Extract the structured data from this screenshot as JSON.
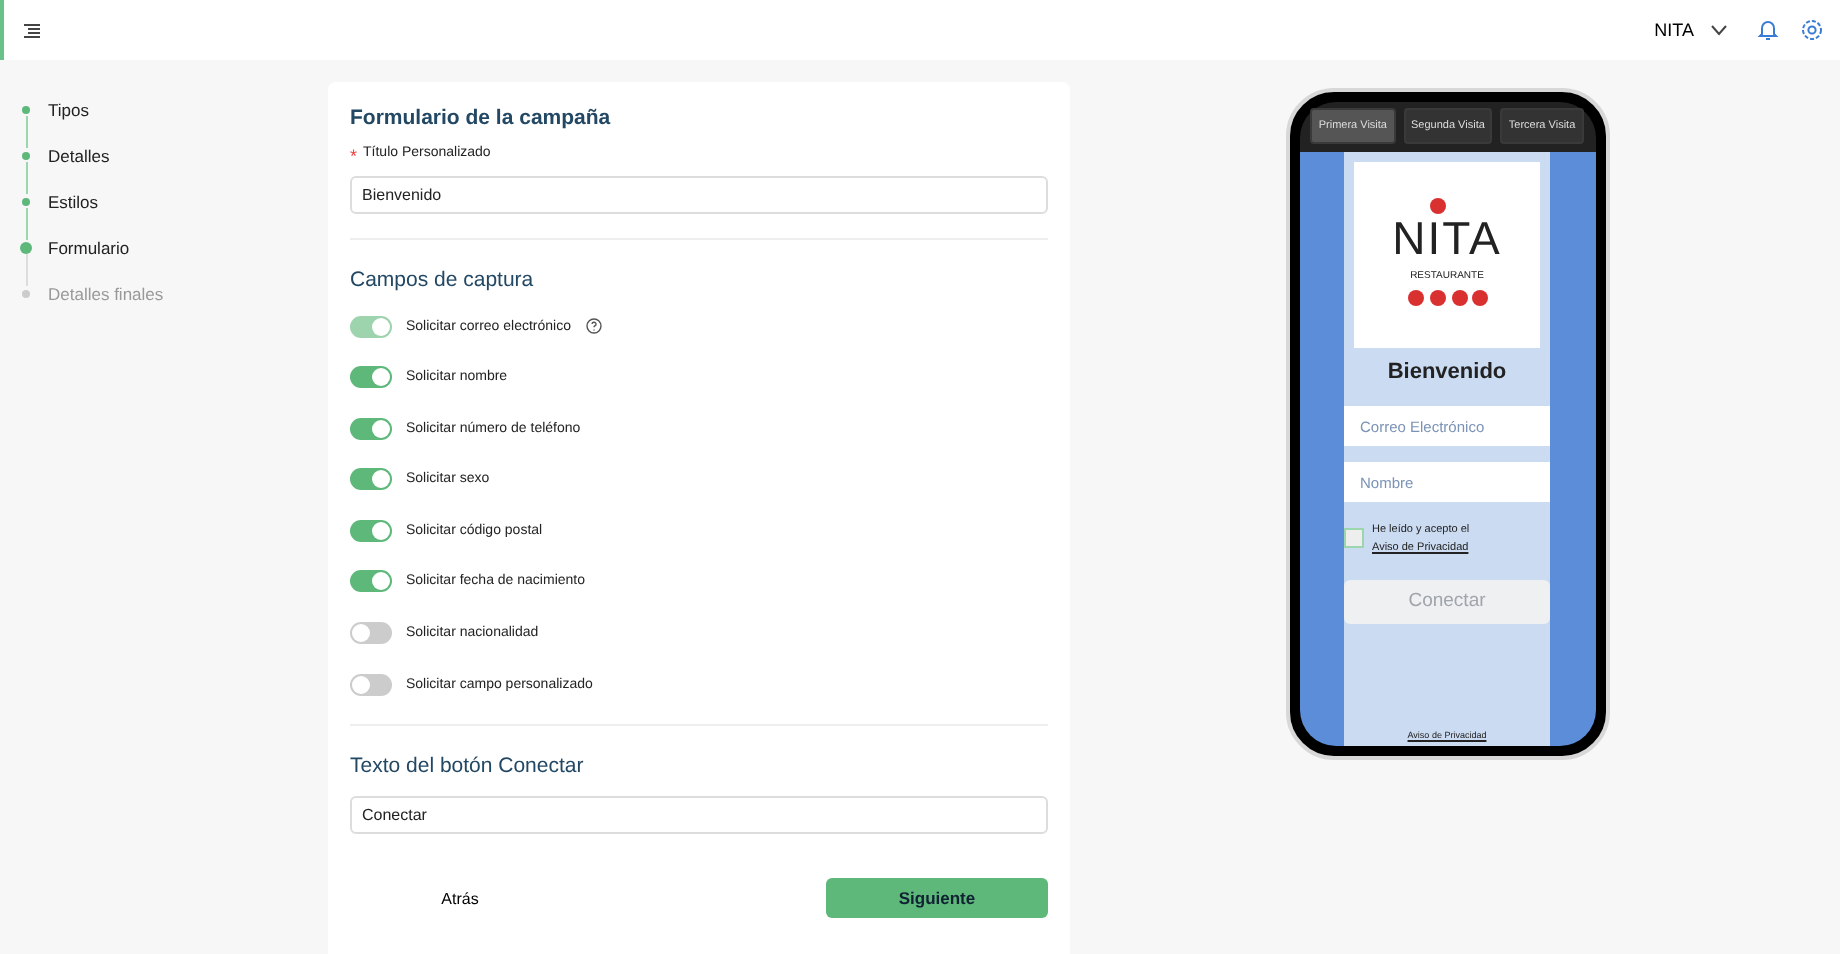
{
  "topbar": {
    "account": "NITA"
  },
  "steps": [
    {
      "label": "Tipos",
      "completed": true,
      "selected": false
    },
    {
      "label": "Detalles",
      "completed": true,
      "selected": false
    },
    {
      "label": "Estilos",
      "completed": true,
      "selected": false
    },
    {
      "label": "Formulario",
      "completed": true,
      "selected": true
    },
    {
      "label": "Detalles finales",
      "completed": false,
      "selected": false
    }
  ],
  "form": {
    "title": "Formulario de la campaña",
    "title_field": {
      "label": "Título Personalizado",
      "required_mark": "*",
      "value": "Bienvenido"
    },
    "capture_heading": "Campos de captura",
    "toggles": [
      {
        "label": "Solicitar correo electrónico",
        "on": true,
        "disabled": true,
        "help": true
      },
      {
        "label": "Solicitar nombre",
        "on": true,
        "disabled": false,
        "help": false
      },
      {
        "label": "Solicitar número de teléfono",
        "on": true,
        "disabled": false,
        "help": false
      },
      {
        "label": "Solicitar sexo",
        "on": true,
        "disabled": false,
        "help": false
      },
      {
        "label": "Solicitar código postal",
        "on": true,
        "disabled": false,
        "help": false
      },
      {
        "label": "Solicitar fecha de nacimiento",
        "on": true,
        "disabled": false,
        "help": false
      },
      {
        "label": "Solicitar nacionalidad",
        "on": false,
        "disabled": false,
        "help": false
      },
      {
        "label": "Solicitar campo personalizado",
        "on": false,
        "disabled": false,
        "help": false
      }
    ],
    "button_heading": "Texto del botón Conectar",
    "button_field": {
      "value": "Conectar"
    },
    "back": "Atrás",
    "next": "Siguiente"
  },
  "preview": {
    "tabs": [
      {
        "label": "Primera Visita",
        "selected": true
      },
      {
        "label": "Segunda Visita",
        "selected": false
      },
      {
        "label": "Tercera Visita",
        "selected": false
      }
    ],
    "logo": {
      "name": "NITA",
      "subtitle": "RESTAURANTE"
    },
    "heading": "Bienvenido",
    "fields": [
      {
        "placeholder": "Correo Electrónico"
      },
      {
        "placeholder": "Nombre"
      }
    ],
    "consent": {
      "checked": false,
      "text": "He leído y acepto el",
      "link": "Aviso de Privacidad"
    },
    "connect": {
      "label": "Conectar",
      "disabled": true
    },
    "footer_link": "Aviso de Privacidad"
  }
}
